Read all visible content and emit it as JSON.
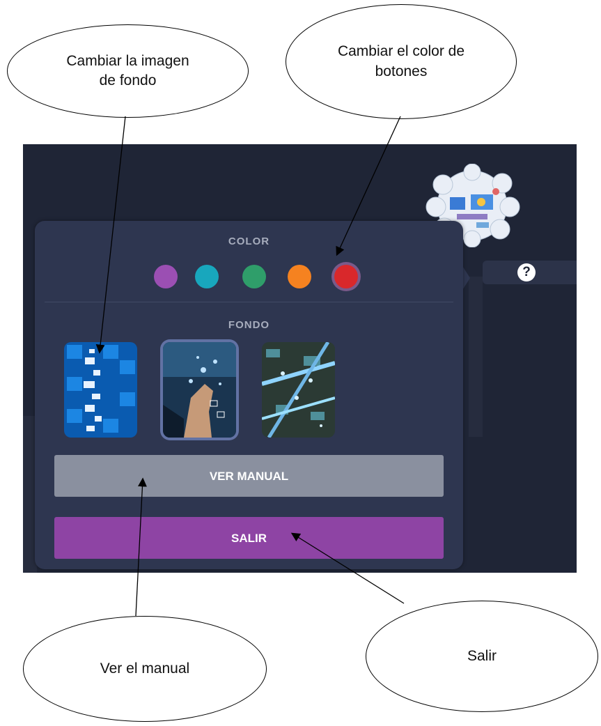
{
  "panel": {
    "color_title": "COLOR",
    "swatches": [
      {
        "name": "purple",
        "color": "#9b4fb3"
      },
      {
        "name": "teal",
        "color": "#18a7bd"
      },
      {
        "name": "green",
        "color": "#2f9e6a"
      },
      {
        "name": "orange",
        "color": "#f58220"
      },
      {
        "name": "red",
        "color": "#d9282b",
        "selected": true
      }
    ],
    "background_title": "FONDO",
    "backgrounds": [
      {
        "name": "blue-devices"
      },
      {
        "name": "hand-touch",
        "selected": true
      },
      {
        "name": "circuit-board"
      }
    ],
    "manual_label": "VER MANUAL",
    "exit_label": "SALIR"
  },
  "help": {
    "icon": "question-icon",
    "glyph": "?"
  },
  "callouts": {
    "background": "Cambiar la imagen de fondo",
    "buttons_color": "Cambiar el color de botones",
    "manual": "Ver el manual",
    "exit": "Salir"
  }
}
